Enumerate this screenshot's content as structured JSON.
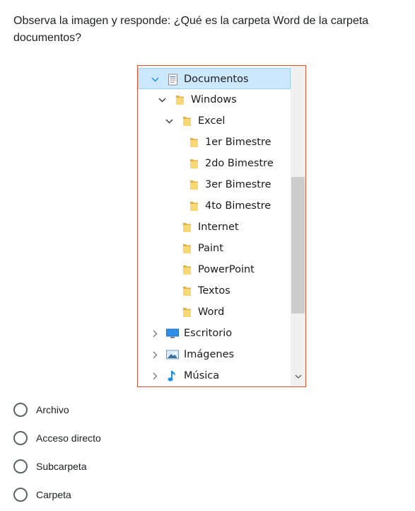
{
  "question": "Observa la imagen y responde: ¿Qué es la carpeta Word de la carpeta documentos?",
  "tree": [
    {
      "label": "Documentos",
      "level": 0,
      "chevron": "expanded",
      "icon": "documents-library-icon",
      "selected": true
    },
    {
      "label": "Windows",
      "level": 1,
      "chevron": "expanded",
      "icon": "folder-icon"
    },
    {
      "label": "Excel",
      "level": 2,
      "chevron": "expanded",
      "icon": "folder-icon"
    },
    {
      "label": "1er Bimestre",
      "level": 3,
      "chevron": "none",
      "icon": "folder-icon"
    },
    {
      "label": "2do Bimestre",
      "level": 3,
      "chevron": "none",
      "icon": "folder-icon"
    },
    {
      "label": "3er Bimestre",
      "level": 3,
      "chevron": "none",
      "icon": "folder-icon"
    },
    {
      "label": "4to Bimestre",
      "level": 3,
      "chevron": "none",
      "icon": "folder-icon"
    },
    {
      "label": "Internet",
      "level": 2,
      "chevron": "none",
      "icon": "folder-icon"
    },
    {
      "label": "Paint",
      "level": 2,
      "chevron": "none",
      "icon": "folder-icon"
    },
    {
      "label": "PowerPoint",
      "level": 2,
      "chevron": "none",
      "icon": "folder-icon"
    },
    {
      "label": "Textos",
      "level": 2,
      "chevron": "none",
      "icon": "folder-icon"
    },
    {
      "label": "Word",
      "level": 2,
      "chevron": "none",
      "icon": "folder-icon"
    },
    {
      "label": "Escritorio",
      "level": 0,
      "chevron": "collapsed",
      "icon": "desktop-icon"
    },
    {
      "label": "Imágenes",
      "level": 0,
      "chevron": "collapsed",
      "icon": "pictures-icon"
    },
    {
      "label": "Música",
      "level": 0,
      "chevron": "collapsed",
      "icon": "music-icon"
    }
  ],
  "options": [
    "Archivo",
    "Acceso directo",
    "Subcarpeta",
    "Carpeta"
  ],
  "colors": {
    "frame_border": "#e2542f",
    "selection_bg": "#cce8ff",
    "folder": "#f8d775",
    "folder_dark": "#e0b13e",
    "chevron_selected": "#1e90e0"
  }
}
